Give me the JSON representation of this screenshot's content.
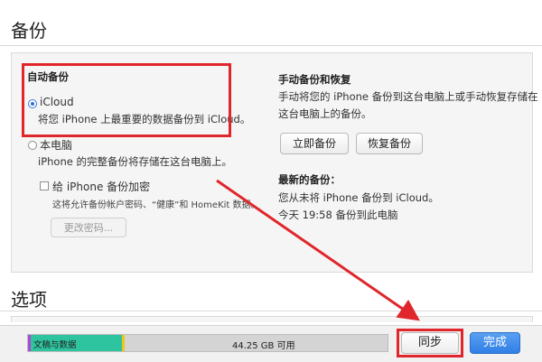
{
  "backup": {
    "title": "备份",
    "auto": {
      "heading": "自动备份",
      "icloud": {
        "label": "iCloud",
        "desc": "将您 iPhone 上最重要的数据备份到 iCloud。"
      },
      "local": {
        "label": "本电脑",
        "desc": "iPhone 的完整备份将存储在这台电脑上。"
      },
      "encrypt": {
        "label": "给 iPhone 备份加密",
        "desc": "这将允许备份帐户密码、“健康”和 HomeKit 数据。"
      },
      "change_password": "更改密码..."
    },
    "manual": {
      "heading": "手动备份和恢复",
      "desc_line1": "手动将您的 iPhone 备份到这台电脑上或手动恢复存储在",
      "desc_line2": "这台电脑上的备份。",
      "backup_now": "立即备份",
      "restore": "恢复备份",
      "latest_heading": "最新的备份：",
      "latest_line1": "您从未将 iPhone 备份到 iCloud。",
      "latest_line2": "今天 19:58 备份到此电脑"
    }
  },
  "options": {
    "title": "选项"
  },
  "footer": {
    "storage": {
      "docs_label": "文稿与数据",
      "free_label": "44.25 GB 可用",
      "colors": {
        "docs": "#2ec4a0",
        "other": "#f0c419",
        "accent": "#b04ad0"
      }
    },
    "sync": "同步",
    "done": "完成"
  },
  "annotation_color": "#e0262b"
}
